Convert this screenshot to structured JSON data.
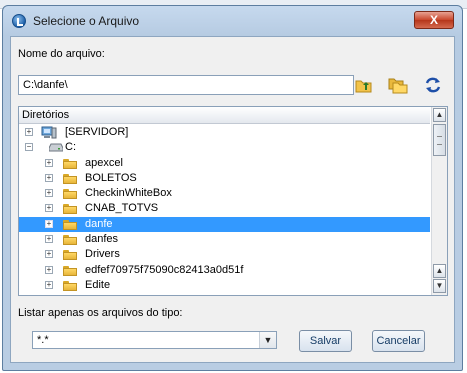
{
  "window": {
    "title": "Selecione o Arquivo",
    "close_label": "X"
  },
  "file_name": {
    "label": "Nome do arquivo:",
    "value": "C:\\danfe\\"
  },
  "tree": {
    "header": "Diretórios",
    "items": [
      {
        "label": "[SERVIDOR]",
        "level": 0,
        "icon": "server-icon",
        "expander": "+",
        "selected": false
      },
      {
        "label": "C:",
        "level": 0,
        "icon": "drive-icon",
        "expander": "−",
        "selected": false
      },
      {
        "label": "apexcel",
        "level": 1,
        "icon": "folder-icon",
        "expander": "+",
        "selected": false
      },
      {
        "label": "BOLETOS",
        "level": 1,
        "icon": "folder-icon",
        "expander": "+",
        "selected": false
      },
      {
        "label": "CheckinWhiteBox",
        "level": 1,
        "icon": "folder-icon",
        "expander": "+",
        "selected": false
      },
      {
        "label": "CNAB_TOTVS",
        "level": 1,
        "icon": "folder-icon",
        "expander": "+",
        "selected": false
      },
      {
        "label": "danfe",
        "level": 1,
        "icon": "folder-icon",
        "expander": "+",
        "selected": true
      },
      {
        "label": "danfes",
        "level": 1,
        "icon": "folder-icon",
        "expander": "+",
        "selected": false
      },
      {
        "label": "Drivers",
        "level": 1,
        "icon": "folder-icon",
        "expander": "+",
        "selected": false
      },
      {
        "label": "edfef70975f75090c82413a0d51f",
        "level": 1,
        "icon": "folder-icon",
        "expander": "+",
        "selected": false
      },
      {
        "label": "Edite",
        "level": 1,
        "icon": "folder-icon",
        "expander": "+",
        "selected": false
      }
    ]
  },
  "filter": {
    "label": "Listar apenas os arquivos do tipo:",
    "value": "*.*"
  },
  "buttons": {
    "save": "Salvar",
    "cancel": "Cancelar"
  },
  "icons": {
    "toolbar": [
      "folder-up-icon",
      "new-folder-icon",
      "refresh-icon"
    ]
  },
  "colors": {
    "selection": "#3399ff",
    "window_frame": "#b9cde3",
    "close_button": "#c9462c"
  }
}
